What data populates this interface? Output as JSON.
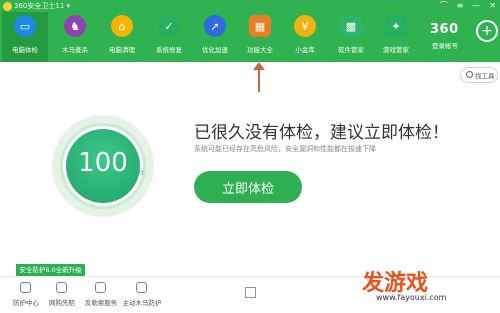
{
  "window": {
    "title": "360安全卫士11 ▾",
    "controls": [
      "⌒",
      "≡",
      "—",
      "✕"
    ]
  },
  "tabs": [
    {
      "label": "电脑体检",
      "icon": "monitor-icon",
      "color": "#1e88e5",
      "glyph": "▭"
    },
    {
      "label": "木马查杀",
      "icon": "horse-icon",
      "color": "#8e44ad",
      "glyph": "♞"
    },
    {
      "label": "电脑清理",
      "icon": "broom-icon",
      "color": "#f5b400",
      "glyph": "⌂"
    },
    {
      "label": "系统修复",
      "icon": "shield-icon",
      "color": "#27ae60",
      "glyph": "✓"
    },
    {
      "label": "优化加速",
      "icon": "rocket-icon",
      "color": "#2d6cdf",
      "glyph": "➚"
    },
    {
      "label": "功能大全",
      "icon": "grid-icon",
      "color": "#e67e22",
      "glyph": "▦"
    },
    {
      "label": "小金库",
      "icon": "coin-icon",
      "color": "#f1b20f",
      "glyph": "¥"
    },
    {
      "label": "软件管家",
      "icon": "apps-icon",
      "color": "#2db36a",
      "glyph": "▩"
    },
    {
      "label": "游戏管家",
      "icon": "gamepad-icon",
      "color": "#27ae60",
      "glyph": "✦"
    }
  ],
  "account": {
    "logo": "360",
    "login_label": "登录帐号"
  },
  "toolbox": {
    "label": "找工具"
  },
  "score": {
    "value": "100",
    "unit": "分"
  },
  "headline": "已很久没有体检，建议立即体检！",
  "subline": "系统可能已经存在高危风险，安全漏洞和性能都在极速下降",
  "check_button": "立即体检",
  "upgrade_badge": "安全防护6.0全新升级",
  "bottom_items": [
    {
      "label": "防护中心",
      "icon": "shield-icon"
    },
    {
      "label": "网购先赔",
      "icon": "cart-icon"
    },
    {
      "label": "反勒索服务",
      "icon": "lock-icon"
    },
    {
      "label": "主动木马防护",
      "icon": "horse-guard-icon"
    }
  ],
  "watermark": {
    "title": "发游戏",
    "url": "www.fayouxi.com"
  }
}
